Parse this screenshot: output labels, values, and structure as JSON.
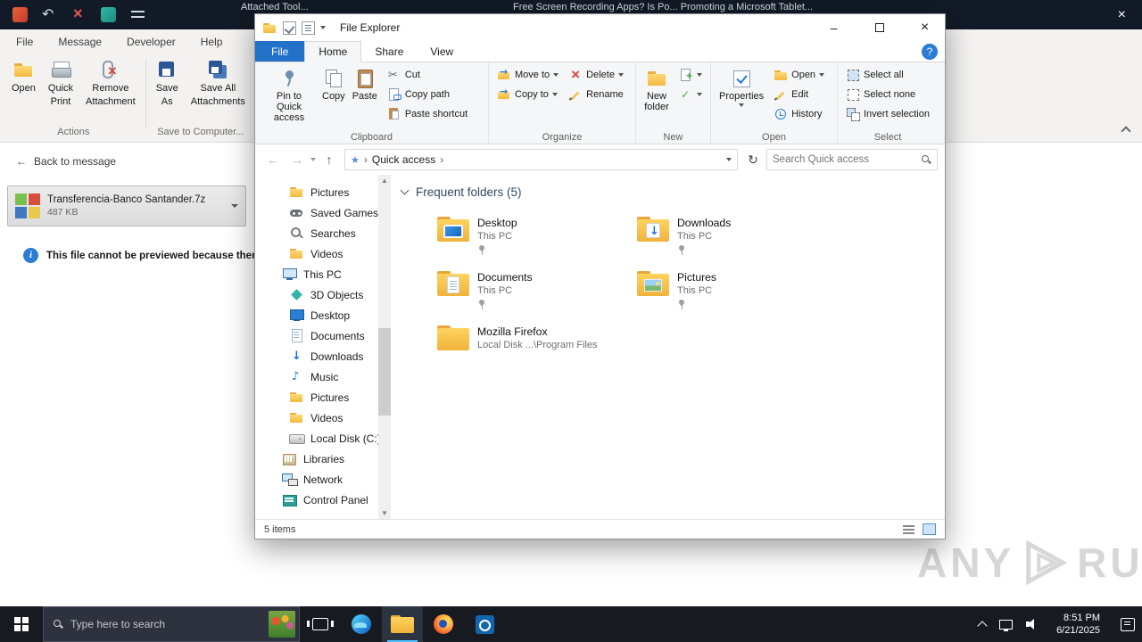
{
  "topbar": {
    "title_left": "Attached Tool...",
    "title_right": "Free Screen Recording Apps? Is Po... Promoting a Microsoft Tablet...",
    "close_glyph": "×"
  },
  "outlook": {
    "tabs": [
      {
        "label": "File"
      },
      {
        "label": "Message"
      },
      {
        "label": "Developer"
      },
      {
        "label": "Help"
      }
    ],
    "ribbon": {
      "buttons": [
        {
          "label1": "Open",
          "label2": ""
        },
        {
          "label1": "Quick",
          "label2": "Print"
        },
        {
          "label1": "Remove",
          "label2": "Attachment"
        },
        {
          "label1": "Save",
          "label2": "As"
        },
        {
          "label1": "Save All",
          "label2": "Attachments"
        }
      ],
      "group1_label": "Actions",
      "group2_label": "Save to Computer..."
    },
    "back_arrow": "←",
    "back_link": "Back to message",
    "attachment": {
      "filename": "Transferencia-Banco Santander.7z",
      "filesize": "487 KB"
    },
    "preview_notice": "This file cannot be previewed because there"
  },
  "explorer": {
    "title": "File Explorer",
    "window_controls": {
      "min": "–",
      "close": "×"
    },
    "tabs": {
      "file": "File",
      "home": "Home",
      "share": "Share",
      "view": "View"
    },
    "help": "?",
    "ribbon": {
      "pin": "Pin to Quick access",
      "copy": "Copy",
      "paste": "Paste",
      "cut": "Cut",
      "copy_path": "Copy path",
      "paste_shortcut": "Paste shortcut",
      "clipboard_label": "Clipboard",
      "move_to": "Move to",
      "copy_to": "Copy to",
      "delete": "Delete",
      "rename": "Rename",
      "organize_label": "Organize",
      "new_folder": "New folder",
      "new_label": "New",
      "properties": "Properties",
      "open": "Open",
      "edit": "Edit",
      "history": "History",
      "open_label": "Open",
      "select_all": "Select all",
      "select_none": "Select none",
      "invert_selection": "Invert selection",
      "select_label": "Select"
    },
    "address": {
      "back": "←",
      "forward": "→",
      "up": "↑",
      "refresh": "↻",
      "star": "★",
      "sep": "›",
      "breadcrumb": "Quick access",
      "search_placeholder": "Search Quick access"
    },
    "nav": {
      "scroll_up": "▲",
      "scroll_down": "▼",
      "items": [
        {
          "label": "Pictures"
        },
        {
          "label": "Saved Games"
        },
        {
          "label": "Searches"
        },
        {
          "label": "Videos"
        },
        {
          "label": "This PC"
        },
        {
          "label": "3D Objects"
        },
        {
          "label": "Desktop"
        },
        {
          "label": "Documents"
        },
        {
          "label": "Downloads"
        },
        {
          "label": "Music"
        },
        {
          "label": "Pictures"
        },
        {
          "label": "Videos"
        },
        {
          "label": "Local Disk (C:)"
        },
        {
          "label": "Libraries"
        },
        {
          "label": "Network"
        },
        {
          "label": "Control Panel"
        }
      ]
    },
    "main": {
      "section_title": "Frequent folders (5)",
      "tiles": [
        {
          "name": "Desktop",
          "sub": "This PC"
        },
        {
          "name": "Downloads",
          "sub": "This PC"
        },
        {
          "name": "Documents",
          "sub": "This PC"
        },
        {
          "name": "Pictures",
          "sub": "This PC"
        },
        {
          "name": "Mozilla Firefox",
          "sub": "Local Disk ...\\Program Files"
        }
      ]
    },
    "status": {
      "items_count": "5 items"
    }
  },
  "taskbar": {
    "search_placeholder": "Type here to search",
    "clock_time": "8:51 PM",
    "clock_date": "6/21/2025"
  },
  "watermark": {
    "left": "ANY",
    "right": "RUN"
  }
}
